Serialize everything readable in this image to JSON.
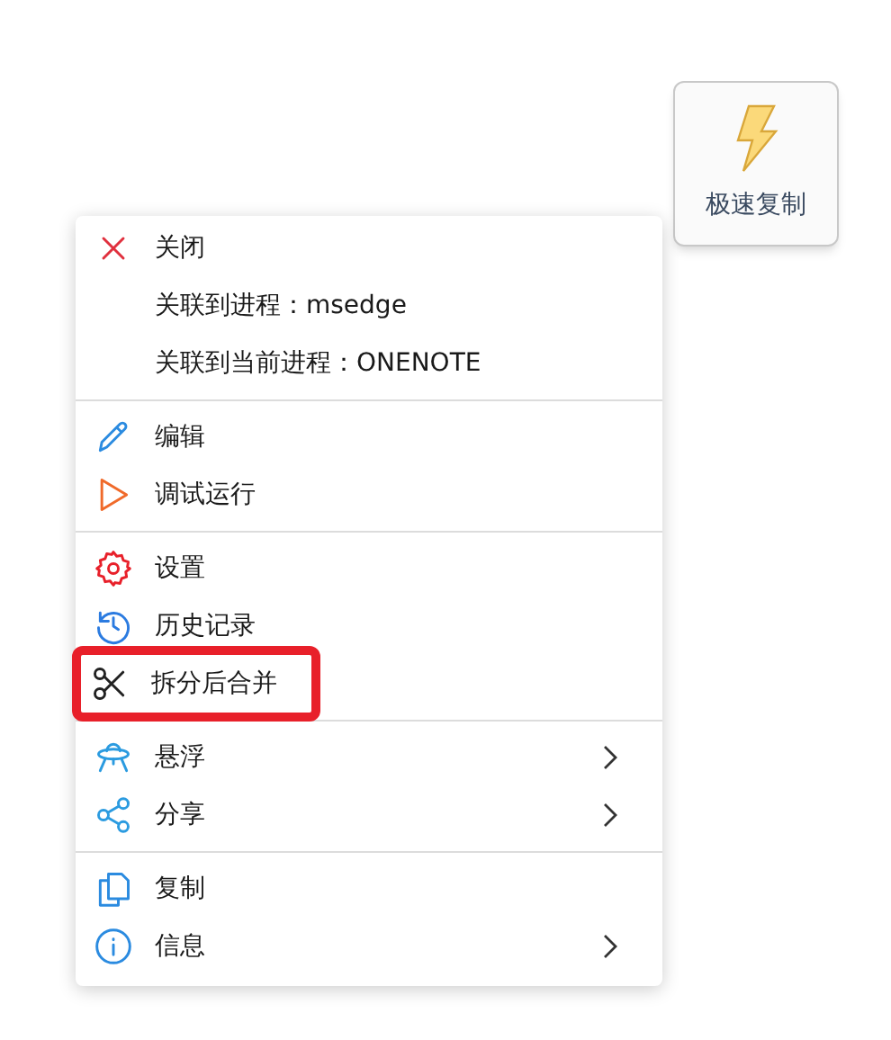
{
  "quick_button": {
    "label": "极速复制"
  },
  "menu": {
    "sections": [
      {
        "items": [
          {
            "kind": "close",
            "label": "关闭",
            "submenu": false,
            "highlighted": false
          },
          {
            "kind": "blank",
            "label": "关联到进程：msedge",
            "submenu": false,
            "highlighted": false
          },
          {
            "kind": "blank",
            "label": "关联到当前进程：ONENOTE",
            "submenu": false,
            "highlighted": false
          }
        ]
      },
      {
        "items": [
          {
            "kind": "edit",
            "label": "编辑",
            "submenu": false,
            "highlighted": false
          },
          {
            "kind": "run",
            "label": "调试运行",
            "submenu": false,
            "highlighted": false
          }
        ]
      },
      {
        "items": [
          {
            "kind": "settings",
            "label": "设置",
            "submenu": false,
            "highlighted": false
          },
          {
            "kind": "history",
            "label": "历史记录",
            "submenu": false,
            "highlighted": false
          },
          {
            "kind": "scissors",
            "label": "拆分后合并",
            "submenu": false,
            "highlighted": true
          }
        ]
      },
      {
        "items": [
          {
            "kind": "float",
            "label": "悬浮",
            "submenu": true,
            "highlighted": false
          },
          {
            "kind": "share",
            "label": "分享",
            "submenu": true,
            "highlighted": false
          }
        ]
      },
      {
        "items": [
          {
            "kind": "copy",
            "label": "复制",
            "submenu": false,
            "highlighted": false
          },
          {
            "kind": "info",
            "label": "信息",
            "submenu": true,
            "highlighted": false
          }
        ]
      }
    ]
  }
}
